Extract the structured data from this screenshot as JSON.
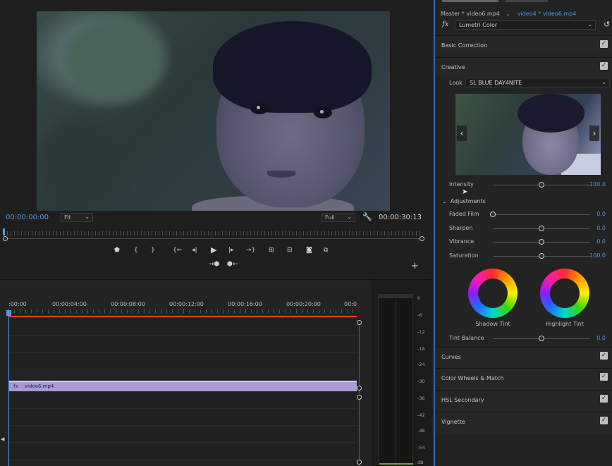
{
  "monitor": {
    "timecode_current": "00:00:00:00",
    "timecode_duration": "00:00:30:13",
    "zoom_select": "Fit",
    "quality_select": "Full"
  },
  "transport": {
    "icons": [
      "marker-icon",
      "mark-in-icon",
      "mark-out-icon",
      "go-to-in-icon",
      "step-back-icon",
      "play-icon",
      "step-forward-icon",
      "go-to-out-icon",
      "lift-icon",
      "extract-icon",
      "camera-icon",
      "compare-icon",
      "insert-icon",
      "overwrite-icon",
      "add-button-icon"
    ]
  },
  "timeline": {
    "ruler": [
      ":00:00",
      "00:00:04:00",
      "00:00:08:00",
      "00:00:12:00",
      "00:00:16:00",
      "00:00:20:00",
      "00:0"
    ],
    "clip_label": "video6.mp4",
    "clip_fx": "fx"
  },
  "meter": {
    "db_labels": [
      "0",
      "-6",
      "-12",
      "-18",
      "-24",
      "-30",
      "-36",
      "-42",
      "-48",
      "-54",
      "dB"
    ]
  },
  "panel": {
    "master_label": "Master * video6.mp4",
    "sequence_label": "video4 * video6.mp4",
    "fx_symbol": "fx",
    "effect_name": "Lumetri Color",
    "sections": {
      "basic_correction": "Basic Correction",
      "creative": "Creative",
      "curves": "Curves",
      "color_wheels": "Color Wheels & Match",
      "hsl_secondary": "HSL Secondary",
      "vignette": "Vignette"
    },
    "look_label": "Look",
    "look_value": "SL BLUE DAY4NITE",
    "intensity": {
      "label": "Intensity",
      "value": "100.0",
      "fraction": 0.5
    },
    "adjustments_label": "Adjustments",
    "faded_film": {
      "label": "Faded Film",
      "value": "0.0",
      "fraction": 0.0
    },
    "sharpen": {
      "label": "Sharpen",
      "value": "0.0",
      "fraction": 0.5
    },
    "vibrance": {
      "label": "Vibrance",
      "value": "0.0",
      "fraction": 0.5
    },
    "saturation": {
      "label": "Saturation",
      "value": "100.0",
      "fraction": 0.5
    },
    "shadow_tint": "Shadow Tint",
    "highlight_tint": "Highlight Tint",
    "tint_balance": {
      "label": "Tint Balance",
      "value": "0.0",
      "fraction": 0.5
    }
  },
  "colors": {
    "accent_blue": "#4f9ae8",
    "clip_purple": "#a99ad6",
    "in_out_red": "#d84b25"
  }
}
